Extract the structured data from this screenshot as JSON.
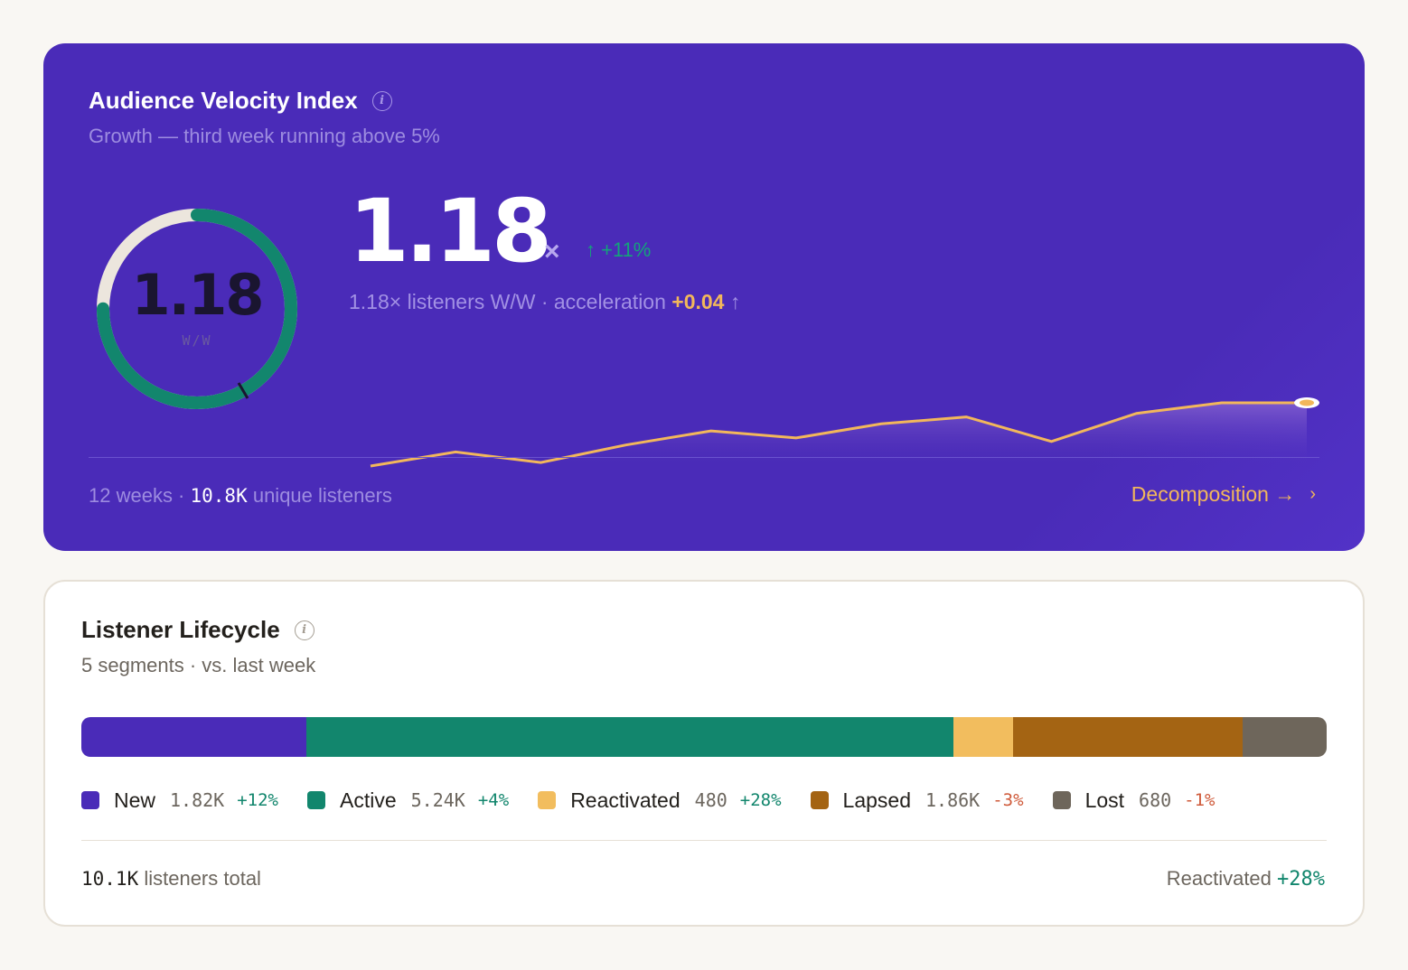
{
  "velocity": {
    "title": "Audience Velocity Index",
    "subtitle": "Growth — third week running above 5%",
    "gauge_value": "1.18",
    "gauge_unit": "W/W",
    "gauge_fraction": 0.75,
    "value": "1.18",
    "multiplier": "×",
    "delta": "↑ +11%",
    "desc_prefix": "1.18× listeners W/W · acceleration ",
    "acceleration": "+0.04",
    "accel_arrow": " ↑",
    "footer_weeks": "12 weeks · ",
    "footer_count": "10.8K",
    "footer_suffix": " unique listeners",
    "link_label": "Decomposition →",
    "link_chevron": "›",
    "sparkline": [
      1.02,
      1.06,
      1.03,
      1.08,
      1.12,
      1.1,
      1.14,
      1.16,
      1.09,
      1.17,
      1.2,
      1.2
    ],
    "colors": {
      "line": "#f2b75b",
      "ring": "#12866d",
      "track": "#ece6dd"
    }
  },
  "lifecycle": {
    "title": "Listener Lifecycle",
    "subtitle": "5 segments · vs. last week",
    "segments": [
      {
        "name": "New",
        "value": "1.82K",
        "share": 1.82,
        "delta": "+12%",
        "trend": "pos",
        "color": "#4a2bb8"
      },
      {
        "name": "Active",
        "value": "5.24K",
        "share": 5.24,
        "delta": "+4%",
        "trend": "pos",
        "color": "#12866d"
      },
      {
        "name": "Reactivated",
        "value": "480",
        "share": 0.48,
        "delta": "+28%",
        "trend": "pos",
        "color": "#f2bd5e"
      },
      {
        "name": "Lapsed",
        "value": "1.86K",
        "share": 1.86,
        "delta": "-3%",
        "trend": "neg",
        "color": "#a46413"
      },
      {
        "name": "Lost",
        "value": "680",
        "share": 0.68,
        "delta": "-1%",
        "trend": "neg",
        "color": "#6e665b"
      }
    ],
    "footer_total": "10.1K",
    "footer_total_suffix": " listeners total",
    "footer_right_label": "Reactivated ",
    "footer_right_delta": "+28%"
  }
}
